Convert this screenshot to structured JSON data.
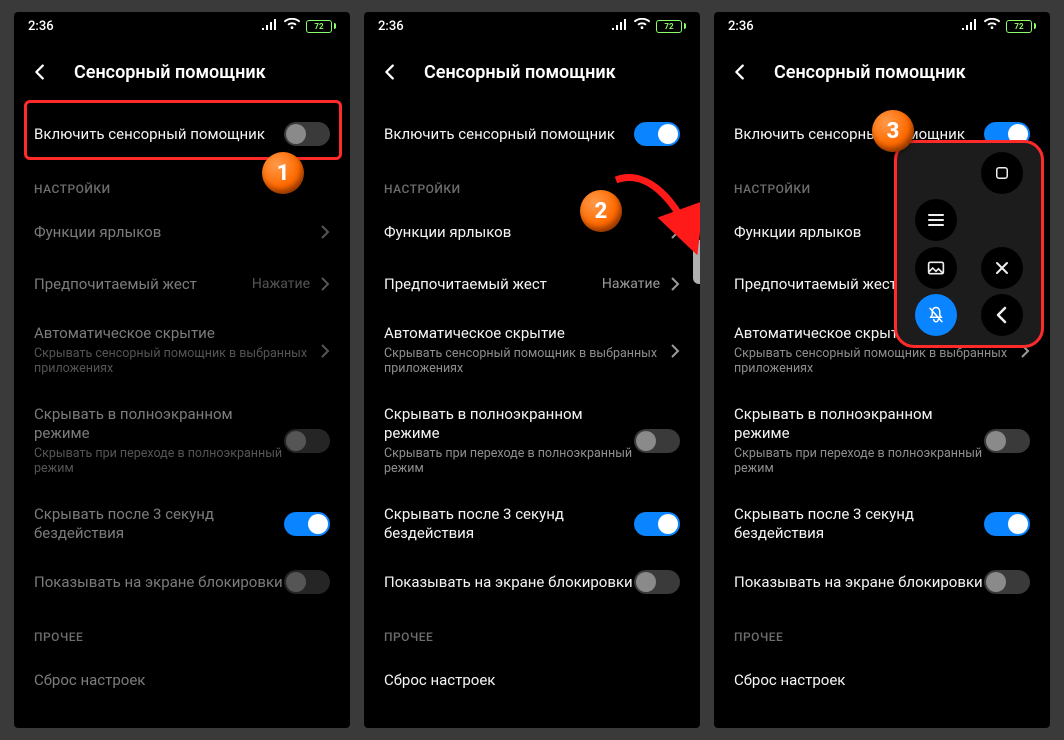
{
  "status": {
    "time": "2:36",
    "battery": "72"
  },
  "header": {
    "title": "Сенсорный помощник"
  },
  "toggleRow": {
    "label": "Включить сенсорный помощник"
  },
  "sections": {
    "settings": "НАСТРОЙКИ",
    "other": "ПРОЧЕЕ"
  },
  "items": {
    "shortcuts": {
      "title": "Функции ярлыков"
    },
    "gesture": {
      "title": "Предпочитаемый жест",
      "value": "Нажатие"
    },
    "autohide": {
      "title": "Автоматическое скрытие",
      "sub": "Скрывать сенсорный помощник в выбранных приложениях"
    },
    "fullscreen": {
      "title": "Скрывать в полноэкранном режиме",
      "sub": "Скрывать при переходе в полноэкранный режим"
    },
    "idle3s": {
      "title": "Скрывать после 3 секунд бездействия"
    },
    "lockscreen": {
      "title": "Показывать на экране блокировки"
    },
    "reset": {
      "title": "Сброс настроек"
    }
  },
  "badges": {
    "b1": "1",
    "b2": "2",
    "b3": "3"
  },
  "atc_icons": {
    "square": "square-icon",
    "menu": "menu-icon",
    "screenshot": "screenshot-icon",
    "close": "close-icon",
    "mute": "mute-icon",
    "back": "back-icon"
  },
  "panels": [
    {
      "master_on": false,
      "dimmed": true
    },
    {
      "master_on": true,
      "dimmed": false
    },
    {
      "master_on": true,
      "dimmed": false
    }
  ]
}
